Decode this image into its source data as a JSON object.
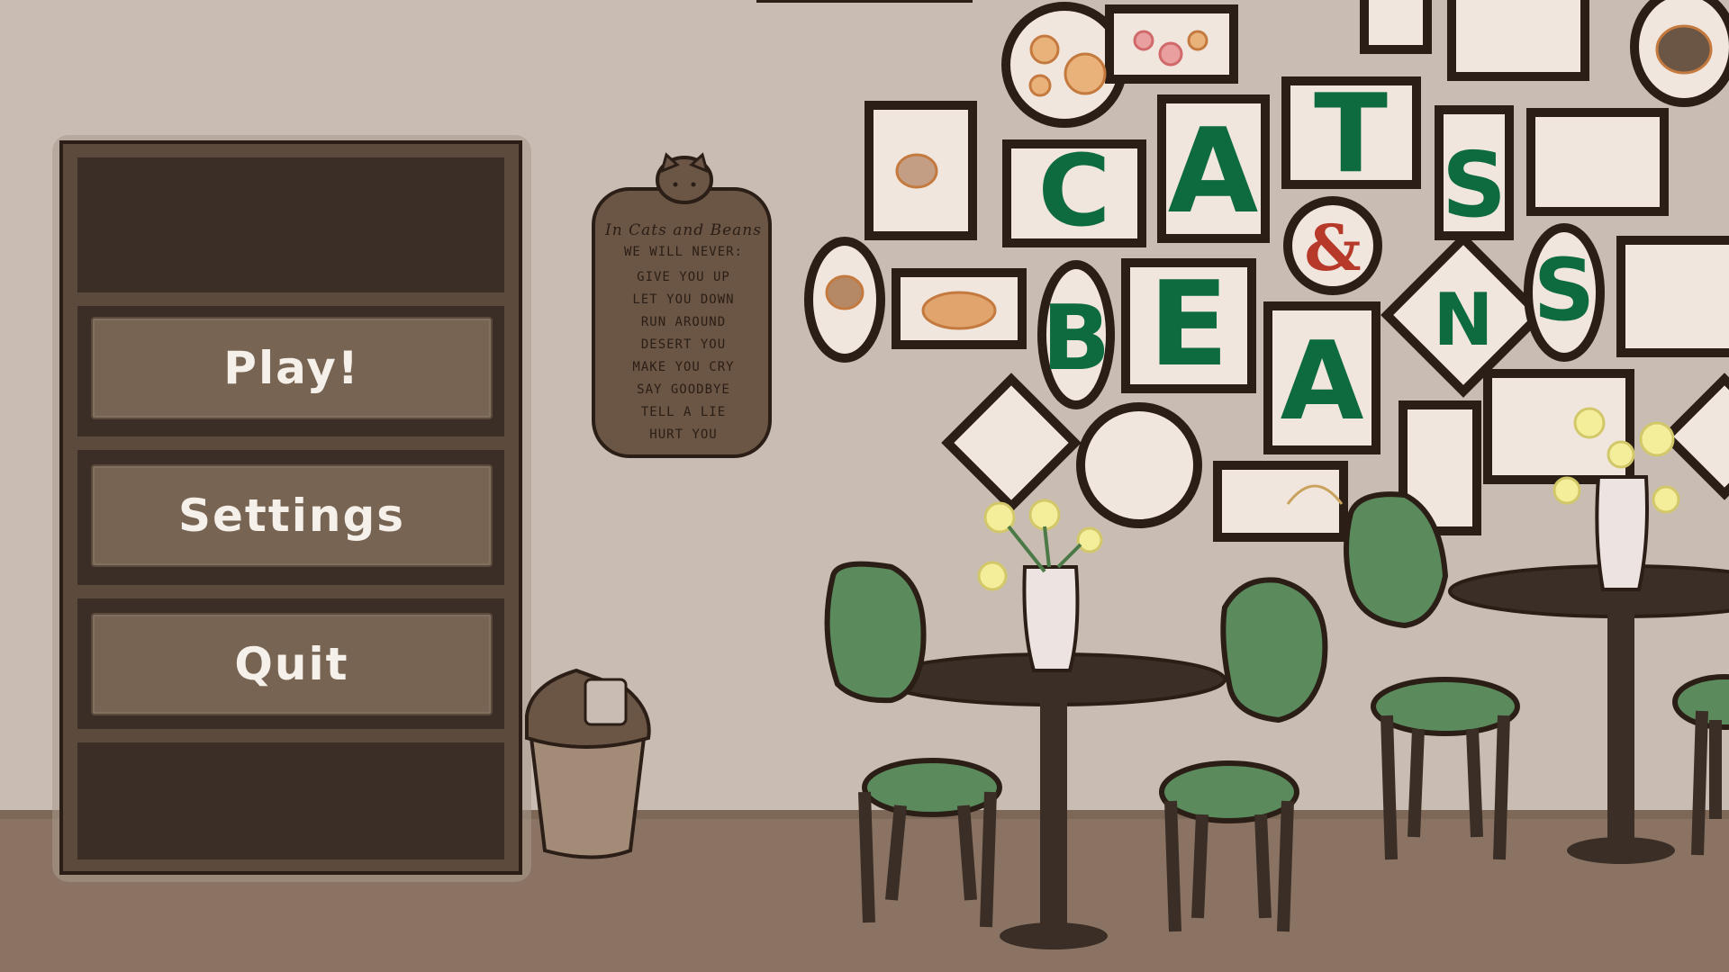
{
  "menu": {
    "play_label": "Play!",
    "settings_label": "Settings",
    "quit_label": "Quit"
  },
  "sign": {
    "title": "In Cats and Beans",
    "subtitle": "WE WILL NEVER:",
    "lines": [
      "GIVE YOU UP",
      "LET YOU DOWN",
      "RUN AROUND",
      "DESERT YOU",
      "MAKE YOU CRY",
      "SAY GOODBYE",
      "TELL A LIE",
      "HURT YOU"
    ]
  },
  "wall_letters": [
    "C",
    "A",
    "T",
    "S",
    "&",
    "B",
    "E",
    "A",
    "N",
    "S"
  ],
  "colors": {
    "wall": "#c9bdb3",
    "floor": "#8a7363",
    "shelf": "#3a2e26",
    "button": "#776453",
    "chair_green": "#5b8a5c",
    "letter_green": "#0d6b3f",
    "ampersand_red": "#b7392a"
  }
}
